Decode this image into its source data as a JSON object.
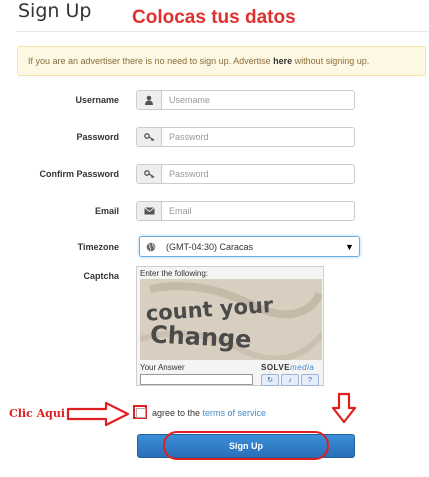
{
  "page": {
    "title": "Sign Up",
    "overlay_title": "Colocas tus datos"
  },
  "notice": {
    "text_before": "If you are an advertiser there is no need to sign up. Advertise ",
    "link": "here",
    "text_after": " without signing up."
  },
  "form": {
    "username": {
      "label": "Username",
      "placeholder": "Usemame",
      "icon": "user-icon"
    },
    "password": {
      "label": "Password",
      "placeholder": "Password",
      "icon": "key-icon"
    },
    "confirm": {
      "label": "Confirm Password",
      "placeholder": "Password",
      "icon": "key-icon"
    },
    "email": {
      "label": "Email",
      "placeholder": "Email",
      "icon": "envelope-icon"
    },
    "timezone": {
      "label": "Timezone",
      "value": "(GMT-04:30) Caracas",
      "icon": "globe-icon"
    },
    "captcha": {
      "label": "Captcha",
      "prompt": "Enter the following:",
      "word1": "count your",
      "word2": "Change",
      "answer_label": "Your Answer",
      "brand_a": "SOLVE",
      "brand_b": "media"
    },
    "agree": {
      "text": "agree to the ",
      "link": "terms of service"
    },
    "submit": "Sign Up"
  },
  "annotation": {
    "clic": "Clic Aqui",
    "color": "#e02020"
  },
  "colors": {
    "primary": "#2a6fb8",
    "link": "#428bca",
    "notice_bg": "#fcf8e3"
  }
}
